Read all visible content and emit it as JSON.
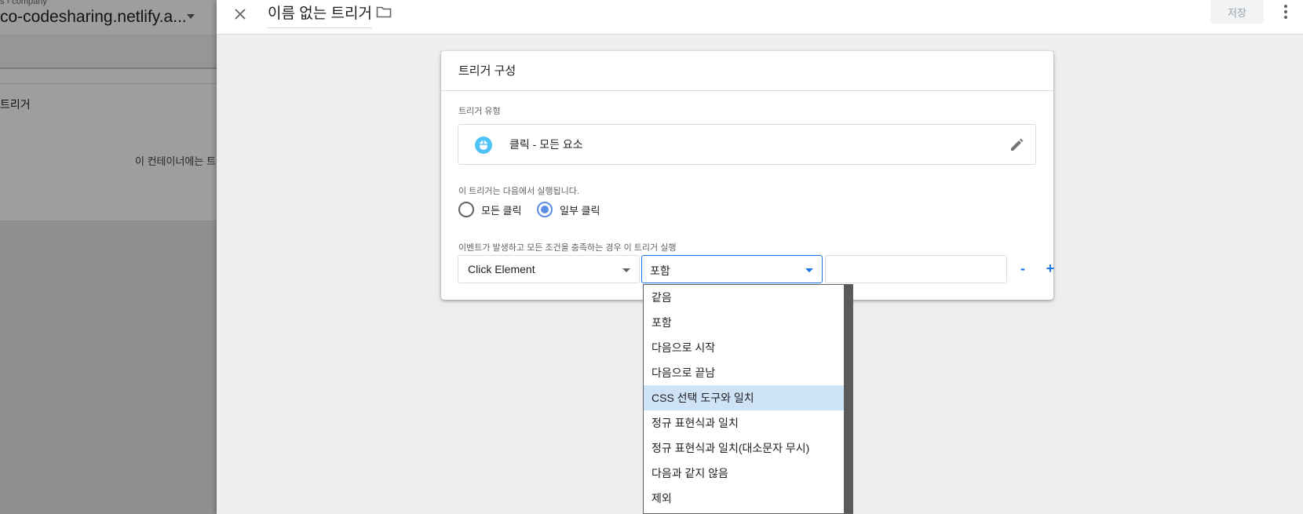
{
  "background": {
    "breadcrumb": "s › company",
    "container_name": "co-codesharing.netlify.a...",
    "list_title": "트리거",
    "empty_text": "이 컨테이너에는 트"
  },
  "sheet": {
    "title": "이름 없는 트리거",
    "save_label": "저장"
  },
  "card": {
    "title": "트리거 구성",
    "type_section_label": "트리거 유형",
    "trigger_type": "클릭 - 모든 요소",
    "fires_on_label": "이 트리거는 다음에서 실행됩니다.",
    "radio_options": [
      {
        "label": "모든 클릭",
        "checked": false
      },
      {
        "label": "일부 클릭",
        "checked": true
      }
    ],
    "condition_label": "이벤트가 발생하고 모든 조건을 충족하는 경우 이 트리거 실행",
    "condition": {
      "variable": "Click Element",
      "operator": "포함",
      "value": ""
    },
    "minus_label": "-",
    "plus_label": "+"
  },
  "dropdown": {
    "options": [
      "같음",
      "포함",
      "다음으로 시작",
      "다음으로 끝남",
      "CSS 선택 도구와 일치",
      "정규 표현식과 일치",
      "정규 표현식과 일치(대소문자 무시)",
      "다음과 같지 않음",
      "제외"
    ],
    "highlighted": "CSS 선택 도구와 일치"
  },
  "colors": {
    "accent": "#1a73e8",
    "radio_checked": "#5c8ee6",
    "highlight": "#cfe3f7",
    "type_icon": "#4fc3f7"
  }
}
